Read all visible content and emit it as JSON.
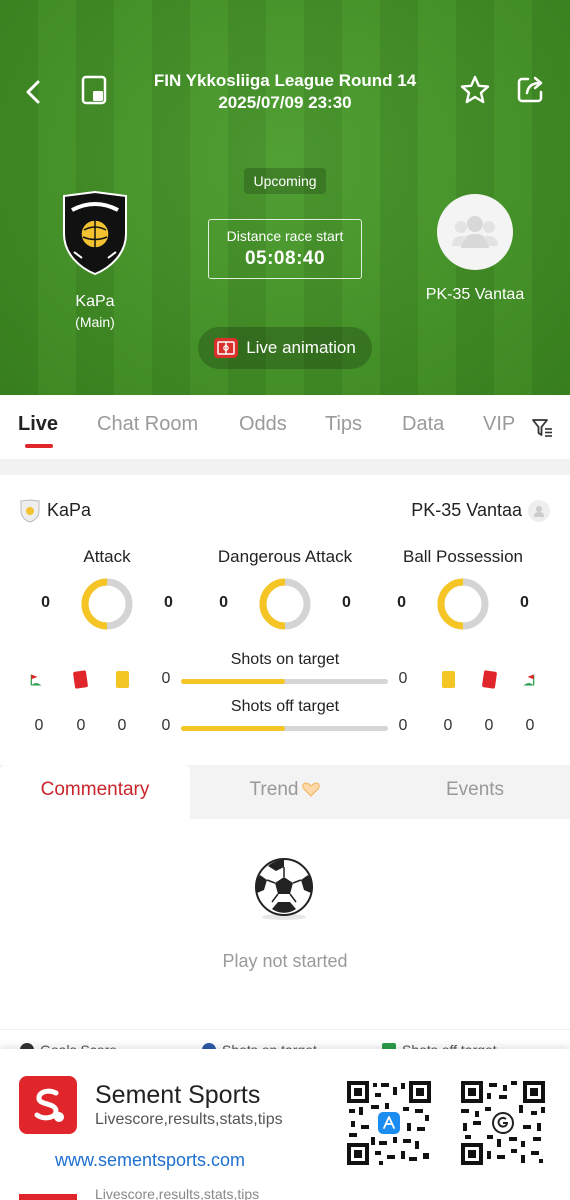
{
  "header": {
    "league_round": "FIN Ykkosliiga League Round 14",
    "datetime": "2025/07/09 23:30",
    "status": "Upcoming",
    "countdown_label": "Distance race start",
    "countdown_time": "05:08:40",
    "live_animation_label": "Live animation"
  },
  "teams": {
    "home": {
      "name": "KaPa",
      "sub": "(Main)"
    },
    "away": {
      "name": "PK-35 Vantaa"
    }
  },
  "tabs": [
    {
      "label": "Live",
      "active": true
    },
    {
      "label": "Chat Room"
    },
    {
      "label": "Odds"
    },
    {
      "label": "Tips"
    },
    {
      "label": "Data"
    },
    {
      "label": "VIP"
    }
  ],
  "stats": {
    "home_name": "KaPa",
    "away_name": "PK-35 Vantaa",
    "gauges": [
      {
        "label": "Attack",
        "home": "0",
        "away": "0",
        "home_share": 0.5
      },
      {
        "label": "Dangerous Attack",
        "home": "0",
        "away": "0",
        "home_share": 0.5
      },
      {
        "label": "Ball Possession",
        "home": "0",
        "away": "0",
        "home_share": 0.5
      }
    ],
    "shots_on_target": {
      "label": "Shots on target",
      "home": "0",
      "away": "0",
      "home_share": 0.5
    },
    "shots_off_target": {
      "label": "Shots off target",
      "home": "0",
      "away": "0",
      "home_share": 0.5
    },
    "home_counts": {
      "corners": "0",
      "red_cards": "0",
      "yellow_cards": "0"
    },
    "away_counts": {
      "yellow_cards": "0",
      "red_cards": "0",
      "corners": "0"
    }
  },
  "commentary_tabs": [
    {
      "label": "Commentary",
      "active": true
    },
    {
      "label": "Trend"
    },
    {
      "label": "Events"
    }
  ],
  "commentary": {
    "empty_text": "Play not started"
  },
  "legend": [
    "Goals Score",
    "Shots on target",
    "Shots off target"
  ],
  "ad": {
    "name": "Sement Sports",
    "tagline": "Livescore,results,stats,tips",
    "url": "www.sementsports.com"
  },
  "colors": {
    "accent": "#e0262a",
    "gauge_fill": "#f5c526",
    "pitch": "#449626"
  }
}
